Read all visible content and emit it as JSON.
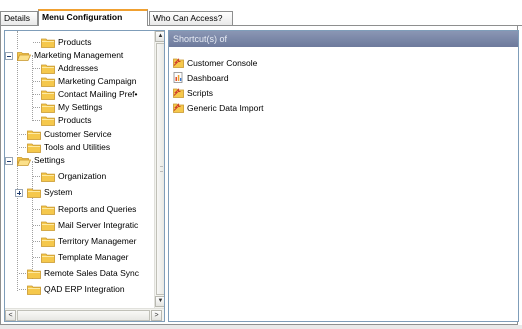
{
  "tabs": [
    {
      "label": "Details",
      "active": false
    },
    {
      "label": "Menu Configuration",
      "active": true
    },
    {
      "label": "Who Can Access?",
      "active": false
    }
  ],
  "tree": {
    "items": [
      {
        "label": "Products",
        "icon": "folder-icon"
      },
      {
        "label": "Marketing Management",
        "icon": "folder-open-icon",
        "expander": "minus"
      },
      {
        "label": "Addresses",
        "icon": "folder-icon"
      },
      {
        "label": "Marketing Campaign",
        "icon": "folder-icon"
      },
      {
        "label": "Contact Mailing Pref•",
        "icon": "folder-icon"
      },
      {
        "label": "My Settings",
        "icon": "folder-icon"
      },
      {
        "label": "Products",
        "icon": "folder-icon"
      },
      {
        "label": "Customer Service",
        "icon": "folder-icon"
      },
      {
        "label": "Tools and Utilities",
        "icon": "folder-icon"
      },
      {
        "label": "Settings",
        "icon": "folder-open-icon",
        "expander": "minus"
      },
      {
        "label": "Organization",
        "icon": "folder-icon"
      },
      {
        "label": "System",
        "icon": "folder-icon",
        "expander": "plus"
      },
      {
        "label": "Reports and Queries",
        "icon": "folder-icon"
      },
      {
        "label": "Mail Server Integratic",
        "icon": "folder-icon"
      },
      {
        "label": "Territory Managemer",
        "icon": "folder-icon"
      },
      {
        "label": "Template Manager",
        "icon": "folder-icon"
      },
      {
        "label": "Remote Sales Data Sync",
        "icon": "folder-icon"
      },
      {
        "label": "QAD ERP Integration",
        "icon": "folder-icon"
      }
    ],
    "scroll_up_glyph": "▲",
    "scroll_down_glyph": "▼",
    "scroll_left_glyph": "<",
    "scroll_right_glyph": ">"
  },
  "shortcuts": {
    "header": "Shortcut(s) of",
    "items": [
      {
        "label": "Customer Console",
        "icon": "shortcut-folder-icon"
      },
      {
        "label": "Dashboard",
        "icon": "dashboard-icon"
      },
      {
        "label": "Scripts",
        "icon": "shortcut-folder-icon"
      },
      {
        "label": "Generic Data Import",
        "icon": "shortcut-folder-icon"
      }
    ]
  },
  "colors": {
    "folder": "#f5c84c",
    "folder_edge": "#c8962c",
    "active_tab_accent": "#f0a030",
    "header_bg": "#7a86a8"
  }
}
